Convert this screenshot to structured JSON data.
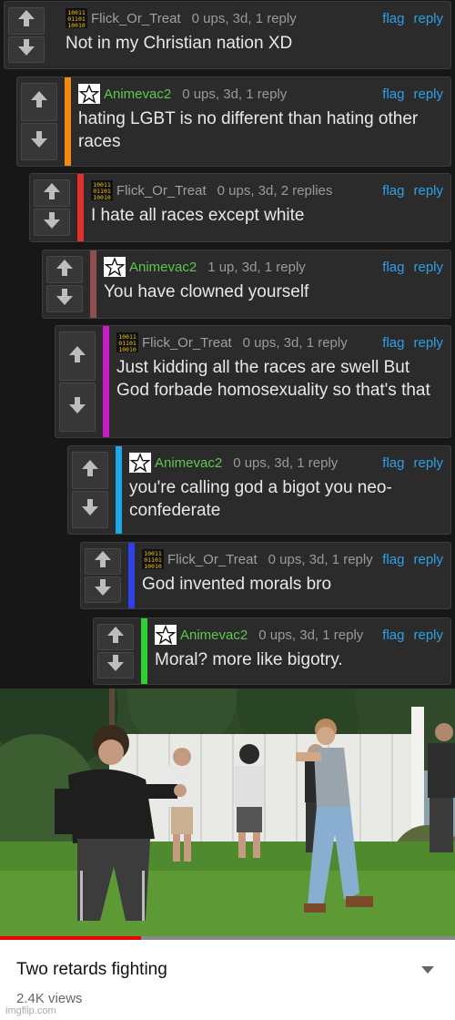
{
  "comments": [
    {
      "user": "Flick_Or_Treat",
      "stats": "0 ups, 3d, 1 reply",
      "flag": "flag",
      "reply": "reply",
      "text": "Not in my Christian nation XD",
      "accent": "#2b2b2b"
    },
    {
      "user": "Animevac2",
      "stats": "0 ups, 3d, 1 reply",
      "flag": "flag",
      "reply": "reply",
      "text": "hating LGBT is no different than hating other races",
      "accent": "#f28a12"
    },
    {
      "user": "Flick_Or_Treat",
      "stats": "0 ups, 3d, 2 replies",
      "flag": "flag",
      "reply": "reply",
      "text": "I hate all races except white",
      "accent": "#e53030"
    },
    {
      "user": "Animevac2",
      "stats": "1 up, 3d, 1 reply",
      "flag": "flag",
      "reply": "reply",
      "text": "You have clowned yourself",
      "accent": "#8f4f4f"
    },
    {
      "user": "Flick_Or_Treat",
      "stats": "0 ups, 3d, 1 reply",
      "flag": "flag",
      "reply": "reply",
      "text": "Just kidding all the races are swell But God forbade homosexuality so that's that",
      "accent": "#c81ec8"
    },
    {
      "user": "Animevac2",
      "stats": "0 ups, 3d, 1 reply",
      "flag": "flag",
      "reply": "reply",
      "text": "you're calling god a bigot you neo-confederate",
      "accent": "#1ea8e8"
    },
    {
      "user": "Flick_Or_Treat",
      "stats": "0 ups, 3d, 1 reply",
      "flag": "flag",
      "reply": "reply",
      "text": "God invented morals bro",
      "accent": "#3040e8"
    },
    {
      "user": "Animevac2",
      "stats": "0 ups, 3d, 1 reply",
      "flag": "flag",
      "reply": "reply",
      "text": "Moral? more like bigotry.",
      "accent": "#2ed22e"
    }
  ],
  "video": {
    "title": "Two retards fighting",
    "views": "2.4K views",
    "progress_fraction": 0.31
  },
  "watermark": "imgflip.com",
  "colors": {
    "background": "#171717",
    "comment_bg": "#2b2b2b",
    "link": "#2ea0e8",
    "username_animevac": "#5cc84c"
  },
  "icons": {
    "upvote": "arrow-up-icon",
    "downvote": "arrow-down-icon",
    "flick_avatar": "binary-avatar-icon",
    "animevac_avatar": "star-avatar-icon"
  }
}
